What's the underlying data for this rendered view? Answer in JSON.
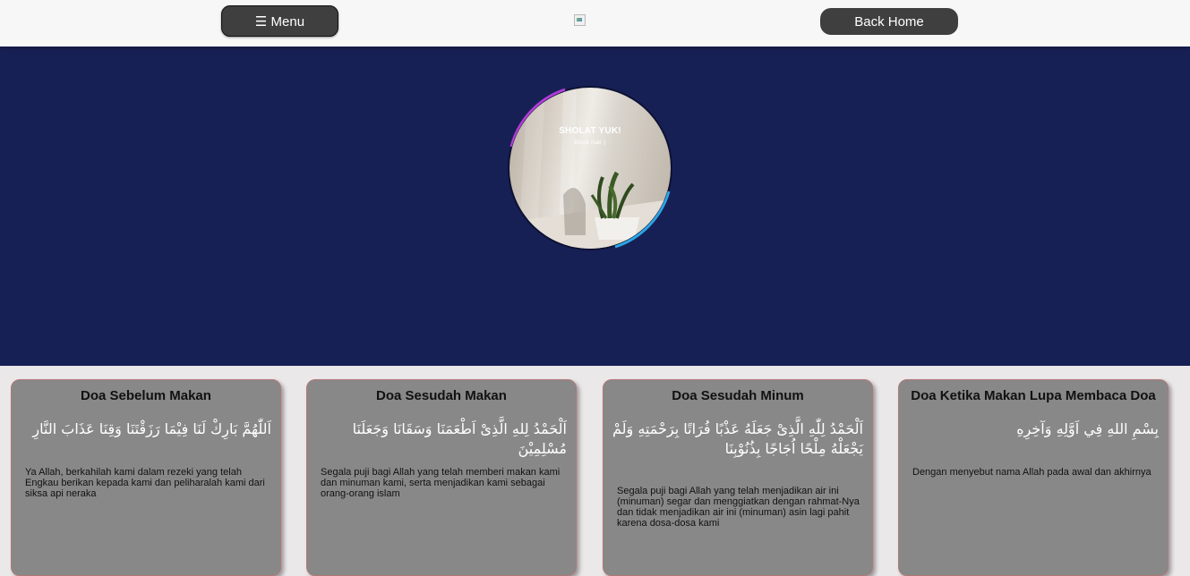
{
  "header": {
    "menu_label": "☰ Menu",
    "logo_alt": "",
    "home_label": "Back Home"
  },
  "hero": {
    "story_title": "SHOLAT YUK!",
    "story_subtitle": "Besok mati :)"
  },
  "cards": [
    {
      "title": "Doa Sebelum Makan",
      "arabic": "اَللّٰهُمَّ بَارِكْ لَنَا فِيْمَا رَزَقْتَنَا وَقِنَا عَذَابَ النَّارِ",
      "translation": "Ya Allah, berkahilah kami dalam rezeki yang telah Engkau berikan kepada kami dan peliharalah kami dari siksa api neraka"
    },
    {
      "title": "Doa Sesudah Makan",
      "arabic": "اَلْحَمْدُ لِلهِ الَّذِىْ اَطْعَمَنَا وَسَقَانَا وَجَعَلَنَا مُسْلِمِيْنَ",
      "translation": "Segala puji bagi Allah yang telah memberi makan kami dan minuman kami, serta menjadikan kami sebagai orang-orang islam"
    },
    {
      "title": "Doa Sesudah Minum",
      "arabic": "اَلْحَمْدُ لِلّٰهِ الَّذِىْ جَعَلَهُ عَذْبًا فُرَاتًا بِرَحْمَتِهِ وَلَمْ يَجْعَلْهُ مِلْحًا اُجَاجًا بِذُنُوْبِنَا",
      "translation": "Segala puji bagi Allah yang telah menjadikan air ini (minuman) segar dan menggiatkan dengan rahmat-Nya dan tidak menjadikan air ini (minuman) asin lagi pahit karena dosa-dosa kami"
    },
    {
      "title": "Doa Ketika Makan Lupa Membaca Doa",
      "arabic": "بِسْمِ اللهِ فِي اَوَّلِهِ وَآخِرِهِ",
      "translation": "Dengan menyebut nama Allah pada awal dan akhirnya"
    }
  ],
  "colors": {
    "hero_bg": "#172055",
    "button_bg": "#3f3f3f",
    "card_bg": "#888888",
    "page_bg": "#ebe8e9"
  },
  "icons": {
    "menu": "hamburger-icon",
    "logo": "broken-image-icon"
  }
}
